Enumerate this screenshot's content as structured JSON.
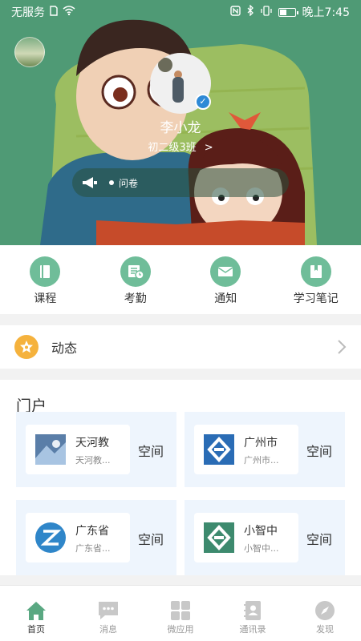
{
  "status_bar": {
    "carrier": "无服务",
    "time": "晚上7:45",
    "battery_level": 0.45
  },
  "profile": {
    "name": "李小龙",
    "class": "初二级3班",
    "class_arrow": ">"
  },
  "notice": {
    "text": "问卷"
  },
  "quick_menu": [
    {
      "label": "课程",
      "icon": "book-icon"
    },
    {
      "label": "考勤",
      "icon": "attendance-icon"
    },
    {
      "label": "通知",
      "icon": "mail-icon"
    },
    {
      "label": "学习笔记",
      "icon": "notebook-icon"
    }
  ],
  "feed": {
    "label": "动态"
  },
  "portal": {
    "title": "门户",
    "cards": [
      {
        "name": "天河教",
        "sub": "天河教...",
        "space": "空间",
        "icon": "photo-icon"
      },
      {
        "name": "广州市",
        "sub": "广州市...",
        "space": "空间",
        "icon": "blue-logo-icon"
      },
      {
        "name": "广东省",
        "sub": "广东省...",
        "space": "空间",
        "icon": "z-logo-icon"
      },
      {
        "name": "小智中",
        "sub": "小智中...",
        "space": "空间",
        "icon": "green-logo-icon"
      }
    ]
  },
  "tabbar": [
    {
      "label": "首页",
      "icon": "home-icon",
      "active": true
    },
    {
      "label": "消息",
      "icon": "message-icon",
      "active": false
    },
    {
      "label": "微应用",
      "icon": "apps-icon",
      "active": false
    },
    {
      "label": "通讯录",
      "icon": "contacts-icon",
      "active": false
    },
    {
      "label": "发现",
      "icon": "compass-icon",
      "active": false
    }
  ],
  "colors": {
    "brand_green": "#6fbd99",
    "header_green": "#4f9a75",
    "star_orange": "#f5b23d",
    "card_bg": "#eef5fd"
  }
}
